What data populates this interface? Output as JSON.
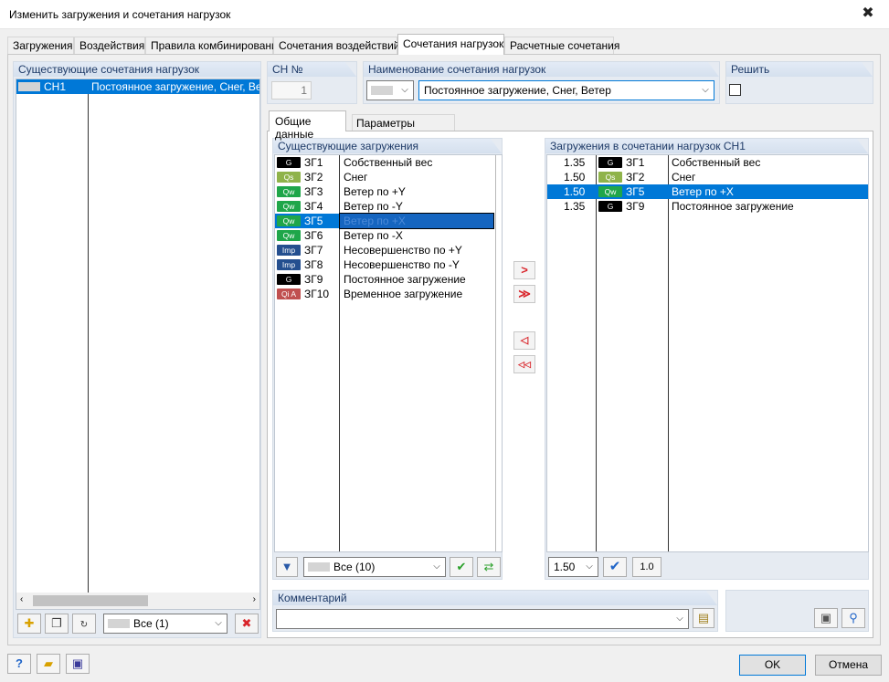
{
  "window": {
    "title": "Изменить загружения и сочетания нагрузок",
    "close_glyph": "✕"
  },
  "tabs": [
    "Загружения",
    "Воздействия",
    "Правила комбинирования",
    "Сочетания воздействий",
    "Сочетания нагрузок",
    "Расчетные сочетания"
  ],
  "active_tab": "Сочетания нагрузок",
  "left_panel": {
    "header": "Существующие сочетания нагрузок",
    "items": [
      {
        "id": "СН1",
        "name": "Постоянное загружение, Снег, Ветер"
      }
    ],
    "filter_value": "Все (1)"
  },
  "ch_number": {
    "label": "СН №",
    "value": "1"
  },
  "combo_name": {
    "label": "Наименование сочетания нагрузок",
    "value": "Постоянное загружение, Снег, Ветер"
  },
  "solve": {
    "label": "Решить",
    "checked": false
  },
  "inner_tabs": [
    "Общие данные",
    "Параметры расчета"
  ],
  "existing_loads": {
    "header": "Существующие загружения",
    "items": [
      {
        "badge": "G",
        "badge_color": "#000000",
        "id": "ЗГ1",
        "name": "Собственный вес"
      },
      {
        "badge": "Qs",
        "badge_color": "#8fb34a",
        "id": "ЗГ2",
        "name": "Снег"
      },
      {
        "badge": "Qw",
        "badge_color": "#1fa64a",
        "id": "ЗГ3",
        "name": "Ветер по +Y"
      },
      {
        "badge": "Qw",
        "badge_color": "#1fa64a",
        "id": "ЗГ4",
        "name": "Ветер по -Y"
      },
      {
        "badge": "Qw",
        "badge_color": "#1fa64a",
        "id": "ЗГ5",
        "name": "Ветер по +X",
        "selected": true
      },
      {
        "badge": "Qw",
        "badge_color": "#1fa64a",
        "id": "ЗГ6",
        "name": "Ветер по -X"
      },
      {
        "badge": "Imp",
        "badge_color": "#244f8f",
        "id": "ЗГ7",
        "name": "Несовершенство по +Y"
      },
      {
        "badge": "Imp",
        "badge_color": "#244f8f",
        "id": "ЗГ8",
        "name": "Несовершенство по -Y"
      },
      {
        "badge": "G",
        "badge_color": "#000000",
        "id": "ЗГ9",
        "name": "Постоянное загружение"
      },
      {
        "badge": "Qi A",
        "badge_color": "#c05050",
        "id": "ЗГ10",
        "name": "Временное загружение"
      }
    ],
    "filter_value": "Все (10)"
  },
  "combo_loads": {
    "header": "Загружения в сочетании нагрузок СН1",
    "items": [
      {
        "factor": "1.35",
        "badge": "G",
        "badge_color": "#000000",
        "id": "ЗГ1",
        "name": "Собственный вес"
      },
      {
        "factor": "1.50",
        "badge": "Qs",
        "badge_color": "#8fb34a",
        "id": "ЗГ2",
        "name": "Снег"
      },
      {
        "factor": "1.50",
        "badge": "Qw",
        "badge_color": "#1fa64a",
        "id": "ЗГ5",
        "name": "Ветер по +X",
        "selected": true
      },
      {
        "factor": "1.35",
        "badge": "G",
        "badge_color": "#000000",
        "id": "ЗГ9",
        "name": "Постоянное загружение"
      }
    ],
    "factor_value": "1.50",
    "unit_factor": "1.0"
  },
  "comment": {
    "label": "Комментарий",
    "value": ""
  },
  "footer": {
    "ok": "OK",
    "cancel": "Отмена"
  },
  "icons": {
    "add_right": ">",
    "add_all_right": "≫",
    "remove_left": "◁",
    "remove_all_left": "◁◁",
    "help": "?",
    "dropdown": "⌵",
    "delete": "✖",
    "check": "✔"
  }
}
